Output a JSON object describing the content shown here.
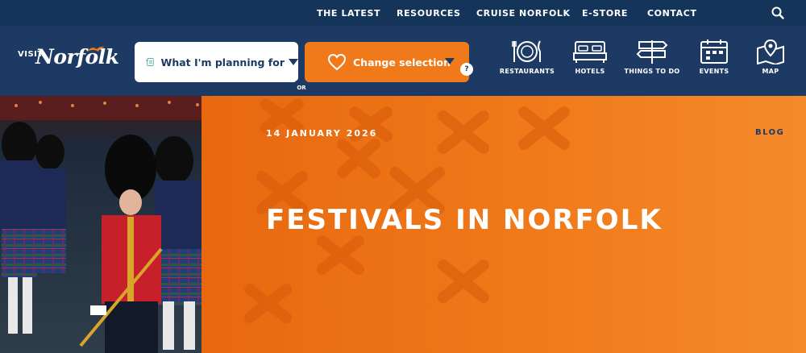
{
  "topbar": {
    "links": [
      "THE LATEST",
      "RESOURCES",
      "CRUISE NORFOLK",
      "E-STORE",
      "CONTACT"
    ],
    "search_icon": "search-icon"
  },
  "brand": {
    "visit": "VISIT",
    "name": "Norfolk"
  },
  "planner": {
    "plan_label": "What I'm planning for",
    "or_label": "OR",
    "change_label": "Change selection",
    "count": "?"
  },
  "nav": [
    {
      "label": "RESTAURANTS",
      "icon": "plate-cutlery-icon"
    },
    {
      "label": "HOTELS",
      "icon": "bed-icon"
    },
    {
      "label": "THINGS TO DO",
      "icon": "signpost-icon"
    },
    {
      "label": "EVENTS",
      "icon": "calendar-icon"
    },
    {
      "label": "MAP",
      "icon": "map-pin-icon"
    }
  ],
  "hero": {
    "date": "14 JANUARY 2026",
    "tag": "BLOG",
    "title": "FESTIVALS IN NORFOLK"
  },
  "colors": {
    "navy": "#1c3a63",
    "topbar": "#15345a",
    "orange": "#f07a1a"
  }
}
